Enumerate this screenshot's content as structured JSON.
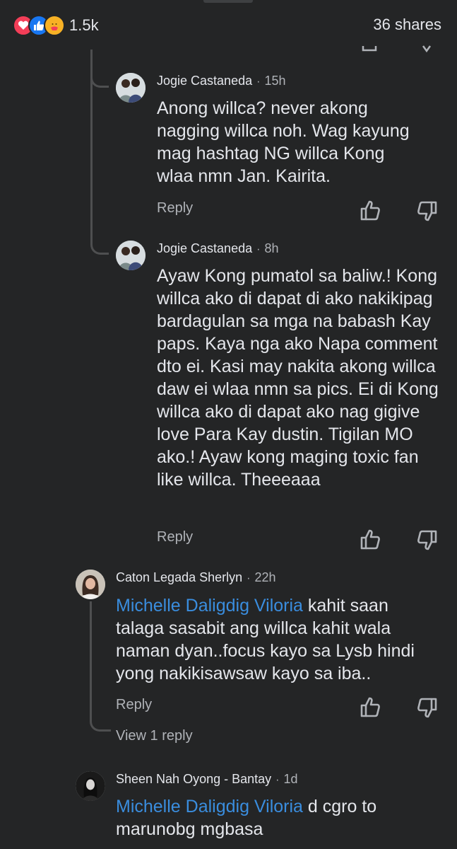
{
  "header": {
    "reaction_count": "1.5k",
    "shares": "36 shares",
    "reaction_icons": [
      "love-icon",
      "like-icon",
      "care-icon"
    ]
  },
  "comments": [
    {
      "author": "Jogie Castaneda",
      "time": "15h",
      "text": "Anong willca? never akong nagging willca noh. Wag kayung mag hashtag NG willca Kong wlaa nmn Jan. Kairita.",
      "reply_label": "Reply"
    },
    {
      "author": "Jogie Castaneda",
      "time": "8h",
      "text": "Ayaw Kong pumatol sa baliw.! Kong willca ako di dapat di ako nakikipag bardagulan sa mga na babash Kay paps. Kaya nga ako Napa comment dto ei. Kasi may nakita akong willca daw ei wlaa nmn sa pics. Ei di Kong willca ako di dapat ako nag gigive love Para Kay dustin. Tigilan MO ako.! Ayaw kong maging toxic fan like willca. Theeeaaa",
      "reply_label": "Reply"
    },
    {
      "author": "Caton Legada Sherlyn",
      "time": "22h",
      "mention": "Michelle Daligdig Viloria",
      "text": " kahit saan talaga sasabit ang willca kahit wala naman dyan..focus kayo sa Lysb hindi yong nakikisawsaw kayo sa iba..",
      "reply_label": "Reply",
      "view_replies": "View 1 reply"
    },
    {
      "author": "Sheen Nah Oyong - Bantay",
      "time": "1d",
      "mention": "Michelle Daligdig Viloria",
      "text": " d cgro to marunobg mgbasa"
    }
  ]
}
